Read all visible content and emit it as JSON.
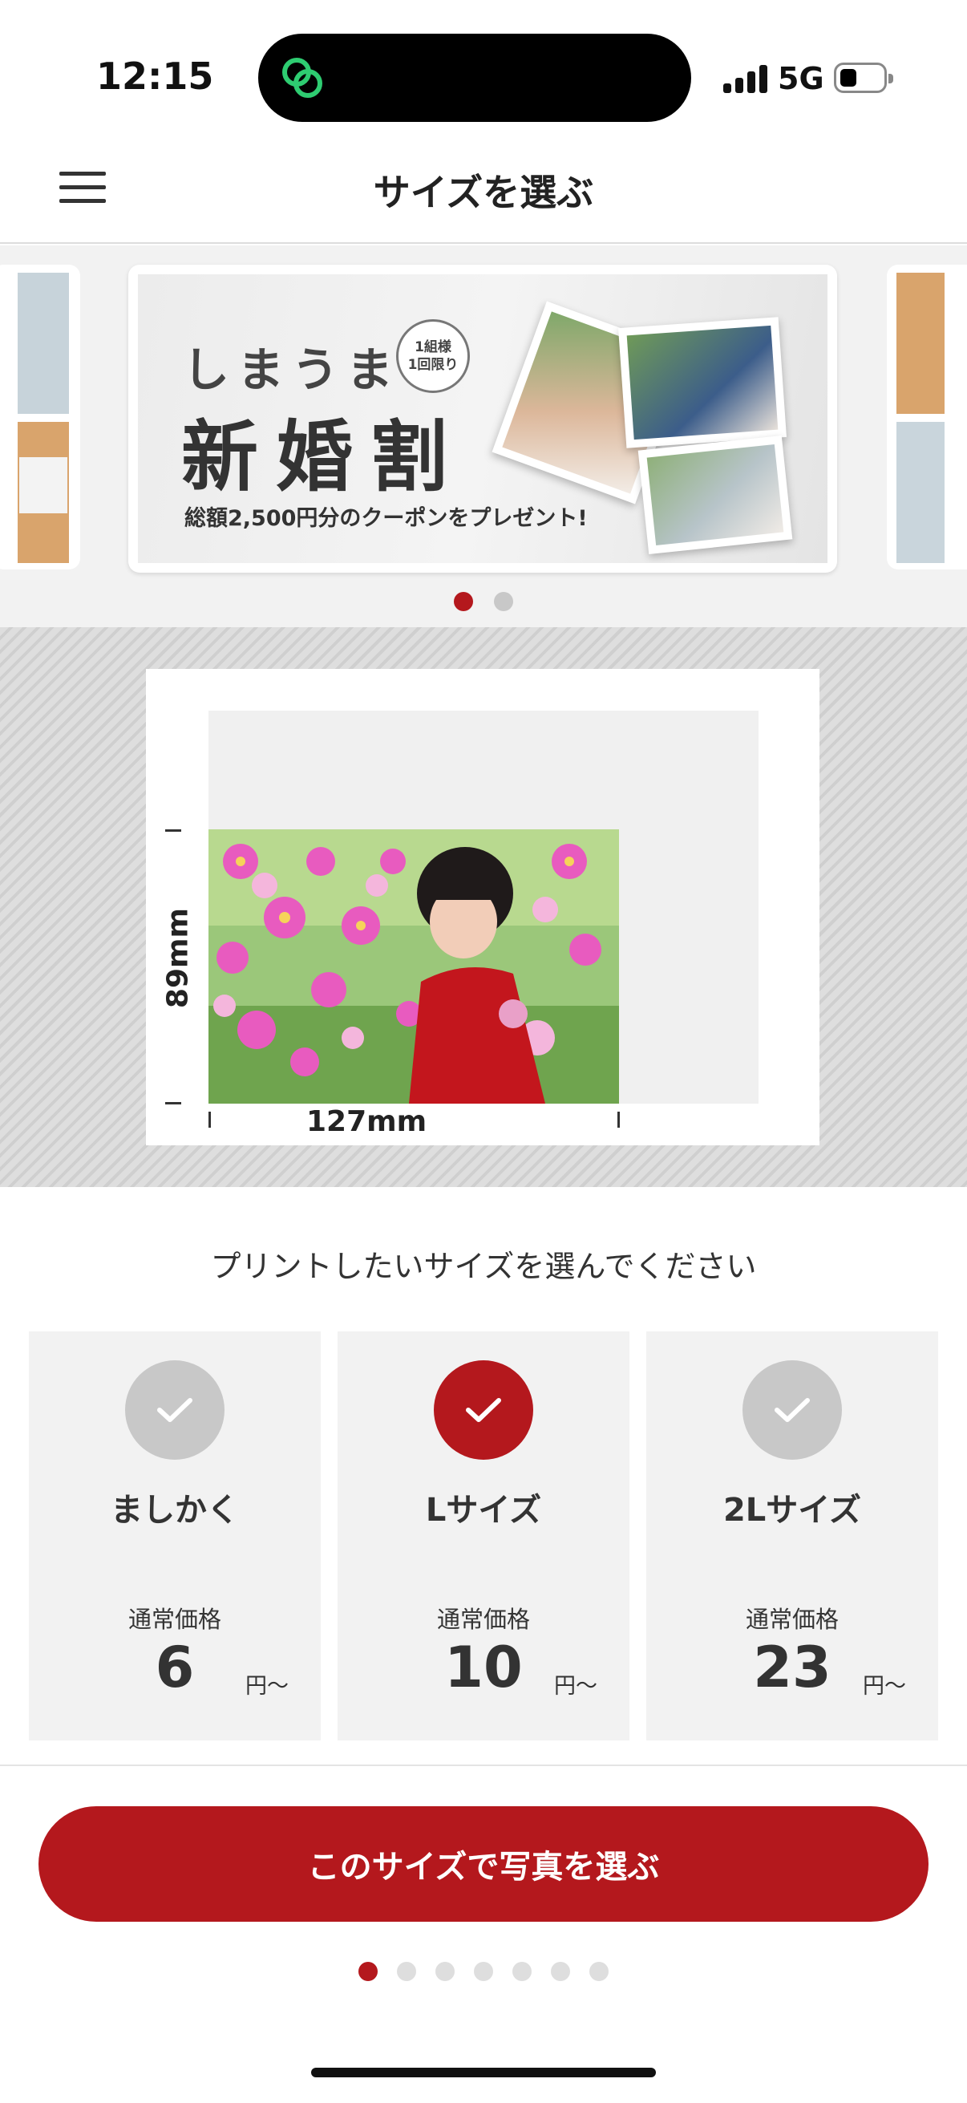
{
  "status_bar": {
    "time": "12:15",
    "network": "5G",
    "battery_percent": 35
  },
  "header": {
    "title": "サイズを選ぶ",
    "menu_icon": "hamburger-menu-icon"
  },
  "banner": {
    "line1": "しまうま",
    "badge": "1組様\n1回限り",
    "line2": "新婚割",
    "line3": "総額2,500円分のクーポンをプレゼント!",
    "active_index": 0,
    "count": 2
  },
  "preview": {
    "width_label": "127mm",
    "height_label": "89mm"
  },
  "selection": {
    "prompt": "プリントしたいサイズを選んでください",
    "options": [
      {
        "name": "ましかく",
        "price_label": "通常価格",
        "price": "6",
        "unit": "円〜",
        "selected": false
      },
      {
        "name": "Lサイズ",
        "price_label": "通常価格",
        "price": "10",
        "unit": "円〜",
        "selected": true
      },
      {
        "name": "2Lサイズ",
        "price_label": "通常価格",
        "price": "23",
        "unit": "円〜",
        "selected": false
      }
    ]
  },
  "cta": {
    "label": "このサイズで写真を選ぶ"
  },
  "pager": {
    "count": 7,
    "active_index": 0
  },
  "colors": {
    "accent": "#b4181d",
    "inactive_check": "#c8c8c8",
    "card_bg": "#f2f2f2"
  }
}
